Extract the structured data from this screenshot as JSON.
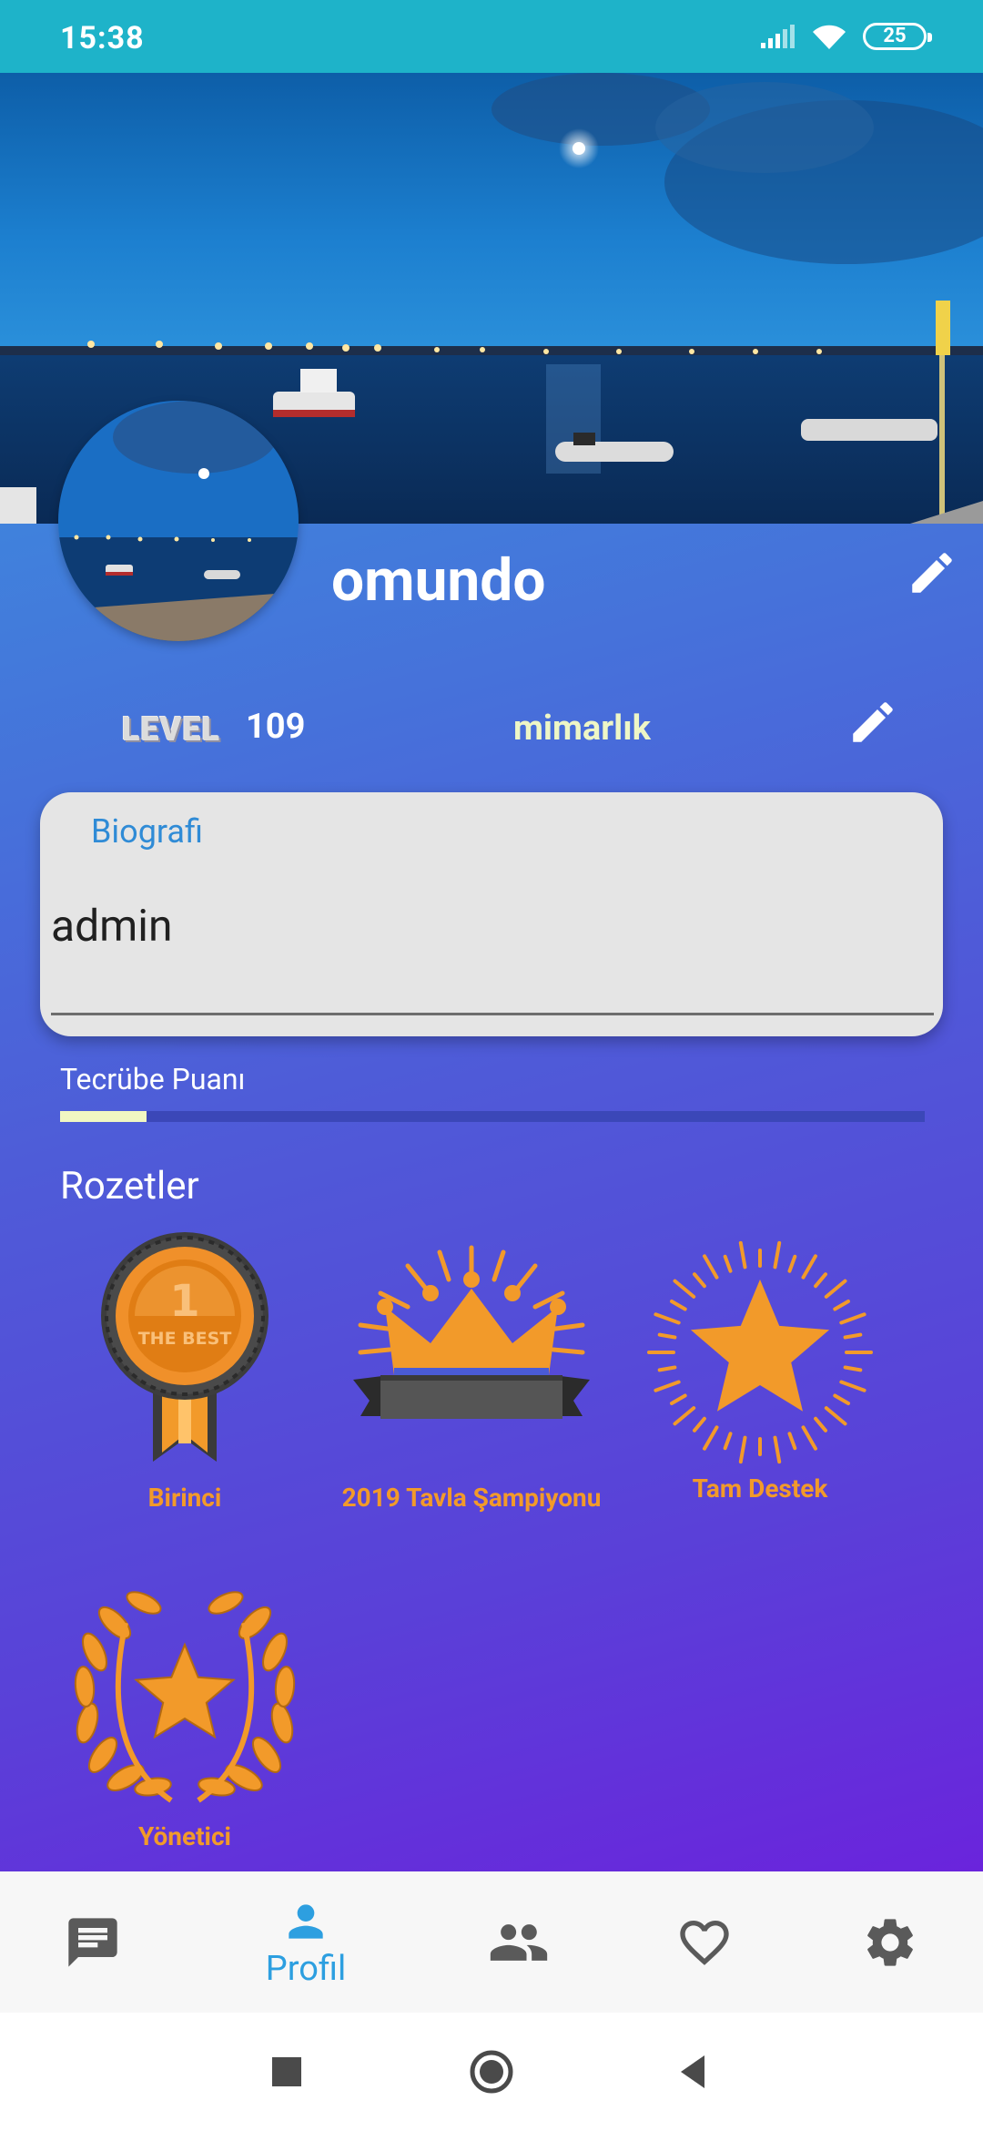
{
  "status_bar": {
    "time": "15:38",
    "battery": "25"
  },
  "profile": {
    "username": "omundo",
    "level_badge": "LEVEL",
    "level_value": "109",
    "profession": "mimarlık"
  },
  "bio": {
    "label": "Biografi",
    "text": "admin"
  },
  "xp": {
    "label": "Tecrübe Puanı",
    "progress_fraction": 0.1
  },
  "badges": {
    "title": "Rozetler",
    "items": [
      {
        "label": "Birinci",
        "icon": "medal-icon"
      },
      {
        "label": "2019 Tavla Şampiyonu",
        "icon": "crown-icon"
      },
      {
        "label": "Tam Destek",
        "icon": "star-burst-icon"
      },
      {
        "label": "Yönetici",
        "icon": "laurel-star-icon"
      }
    ],
    "medal_text": {
      "number": "1",
      "caption": "THE BEST"
    }
  },
  "bottom_nav": {
    "items": [
      {
        "icon": "chat-icon",
        "active": false
      },
      {
        "icon": "person-icon",
        "label": "Profil",
        "active": true
      },
      {
        "icon": "group-icon",
        "active": false
      },
      {
        "icon": "heart-icon",
        "active": false
      },
      {
        "icon": "gear-icon",
        "active": false
      }
    ]
  },
  "colors": {
    "accent": "#2d9fe0",
    "badge_orange": "#f29a2a",
    "status_bar": "#1eb3c9"
  }
}
